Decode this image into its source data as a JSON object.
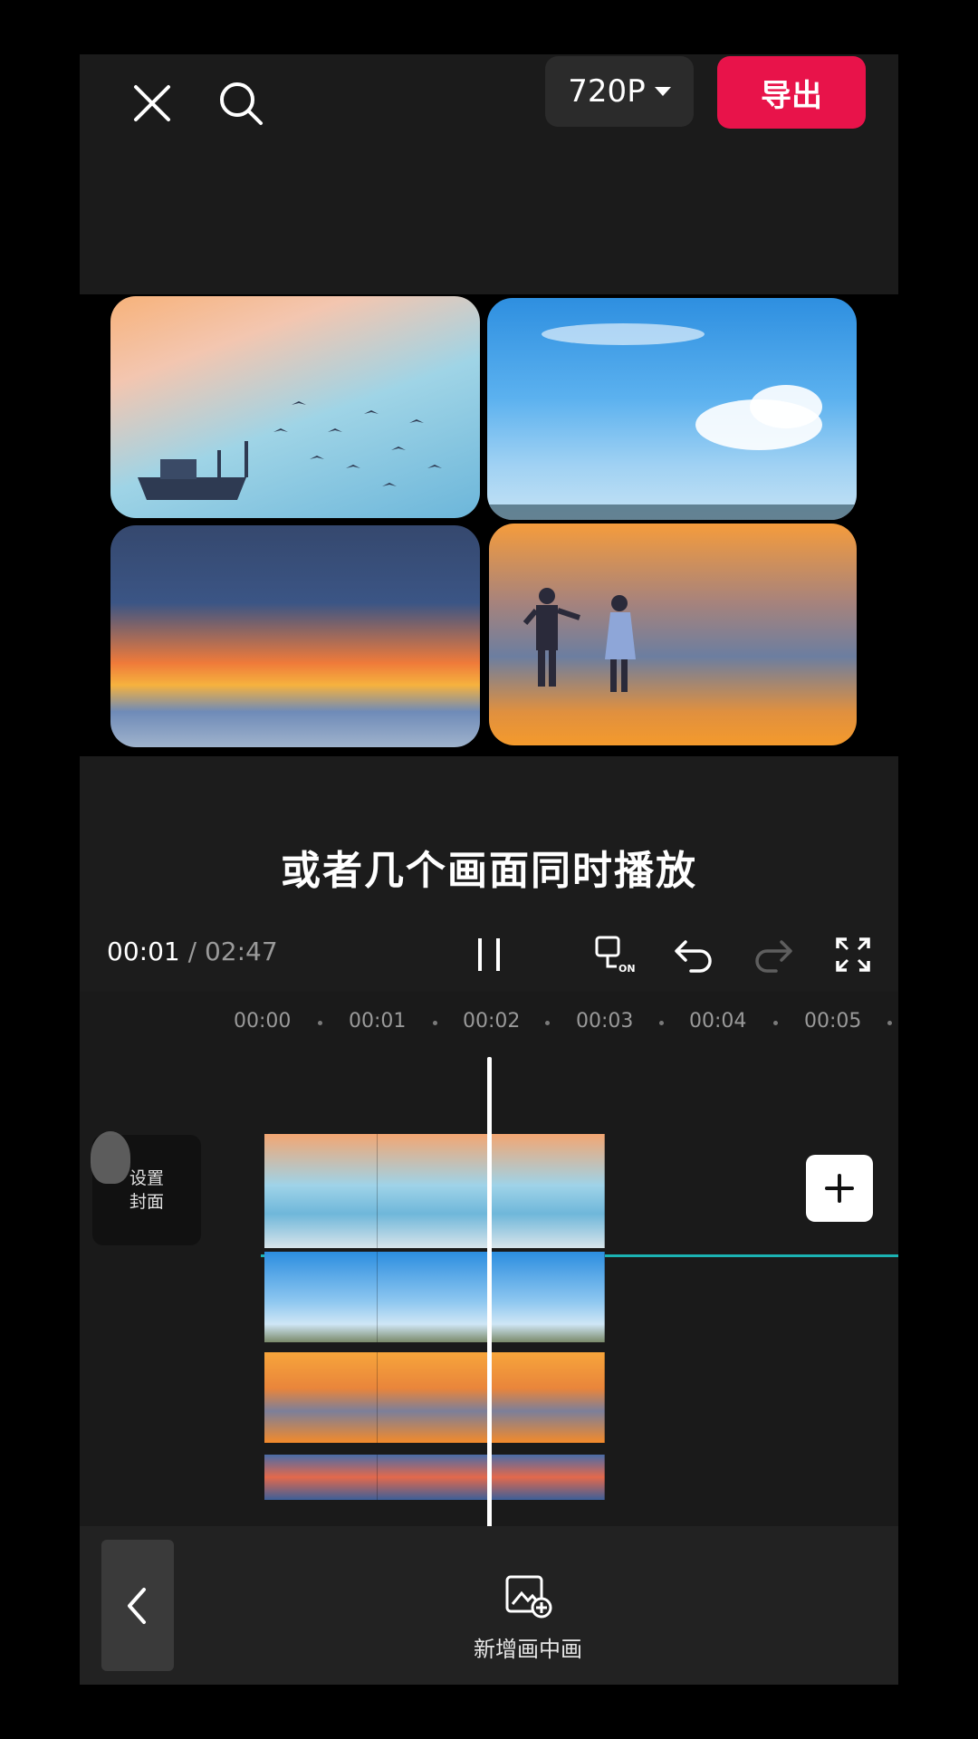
{
  "topbar": {
    "close_icon": "close-icon",
    "search_icon": "search-icon",
    "resolution_label": "720P",
    "export_label": "导出"
  },
  "caption": "或者几个画面同时播放",
  "playback": {
    "current_time": "00:01",
    "separator": "/",
    "total_time": "02:47"
  },
  "timeline": {
    "ruler": [
      "00:00",
      "00:01",
      "00:02",
      "00:03",
      "00:04",
      "00:05"
    ],
    "cover_label": "设置\n封面"
  },
  "bottom": {
    "pip_label": "新增画中画"
  },
  "colors": {
    "accent_export": "#e8134a",
    "track_line": "#1bb3b3"
  }
}
